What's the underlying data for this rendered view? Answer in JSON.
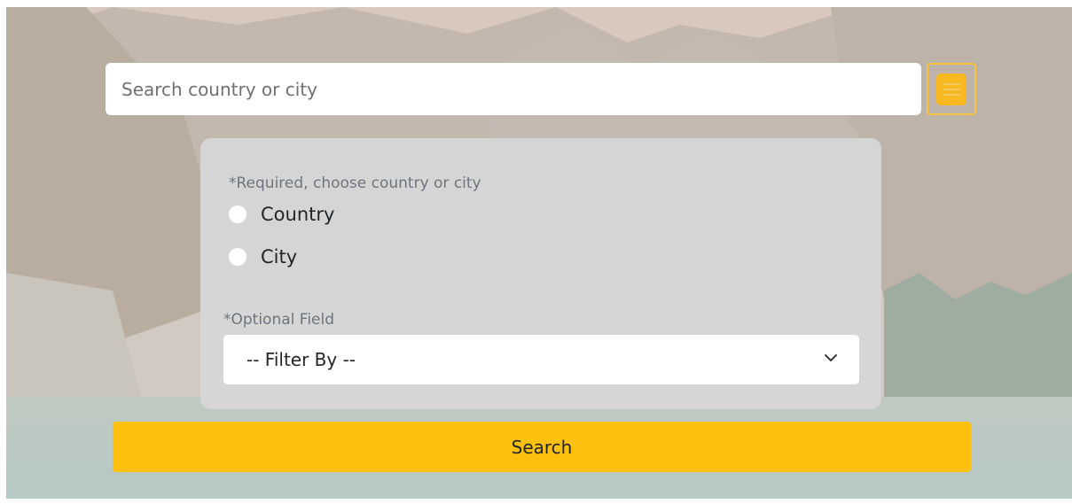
{
  "search": {
    "placeholder": "Search country or city",
    "menu_icon": "hamburger-menu-icon"
  },
  "form": {
    "required_label": "*Required, choose country or city",
    "options": [
      {
        "label": "Country",
        "selected": false
      },
      {
        "label": "City",
        "selected": false
      }
    ],
    "optional_label": "*Optional Field",
    "filter": {
      "selected": "-- Filter By --",
      "icon": "chevron-down-icon"
    },
    "submit_label": "Search"
  },
  "colors": {
    "accent": "#fec00e",
    "menu_button_border": "#f6c343",
    "panel_bg": "#d6d6d6",
    "muted_text": "#6c757d"
  }
}
